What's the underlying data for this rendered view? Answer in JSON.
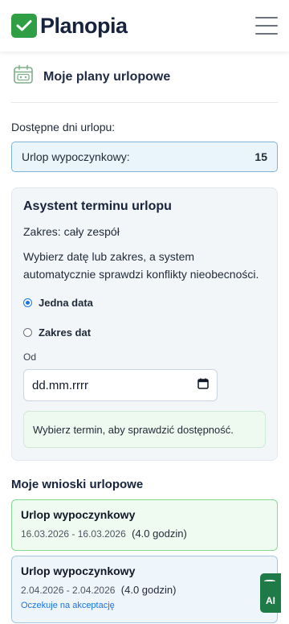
{
  "app": {
    "name": "Planopia"
  },
  "page": {
    "title": "Moje plany urlopowe"
  },
  "days": {
    "label": "Dostępne dni urlopu:",
    "type": "Urlop wypoczynkowy:",
    "value": "15"
  },
  "assistant": {
    "title": "Asystent terminu urlopu",
    "scope": "Zakres: cały zespół",
    "description": "Wybierz datę lub zakres, a system automatycznie sprawdzi konflikty nieobecności.",
    "option_single": "Jedna data",
    "option_range": "Zakres dat",
    "date_label": "Od",
    "date_placeholder": "dd.mm.rrrr",
    "hint": "Wybierz termin, aby sprawdzić dostępność."
  },
  "requests": {
    "title": "Moje wnioski urlopowe",
    "items": [
      {
        "name": "Urlop wypoczynkowy",
        "dates": "16.03.2026 - 16.03.2026",
        "hours": "(4.0 godzin)",
        "status": ""
      },
      {
        "name": "Urlop wypoczynkowy",
        "dates": "2.04.2026 - 2.04.2026",
        "hours": "(4.0 godzin)",
        "status": "Oczekuje na akceptację"
      }
    ]
  },
  "ai_button": {
    "label": "AI"
  },
  "colors": {
    "brand": "#2f9e44",
    "accent": "#1a73e8",
    "approved_bg": "#effbf1",
    "pending_bg": "#eef6fc"
  }
}
